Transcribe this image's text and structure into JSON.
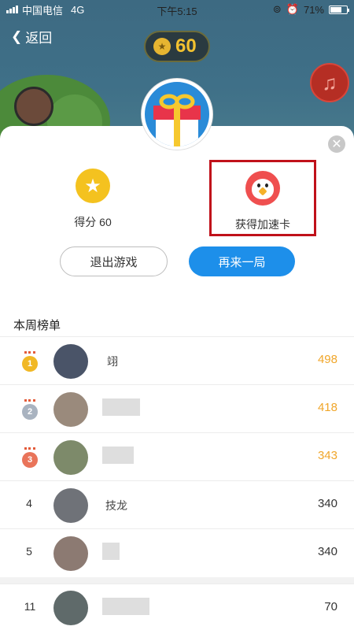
{
  "status_bar": {
    "carrier": "中国电信",
    "network": "4G",
    "time": "下午5:15",
    "battery": "71%",
    "battery_level": 0.71
  },
  "nav": {
    "back_label": "返回",
    "coins": "60"
  },
  "icons": {
    "music": "music-icon",
    "gift": "gift-icon",
    "close": "close-icon",
    "star": "star-icon"
  },
  "colors": {
    "primary": "#1d8fea",
    "gold": "#f0a62a",
    "highlight": "#c0111a"
  },
  "rewards": {
    "score_label": "得分 60",
    "card_label": "获得加速卡"
  },
  "buttons": {
    "exit": "退出游戏",
    "again": "再来一局"
  },
  "leaderboard": {
    "title": "本周榜单",
    "rows": [
      {
        "rank": "1",
        "name": "翊",
        "score": "498"
      },
      {
        "rank": "2",
        "name": "",
        "score": "418"
      },
      {
        "rank": "3",
        "name": "",
        "score": "343"
      },
      {
        "rank": "4",
        "name": "​技龙",
        "score": "340"
      },
      {
        "rank": "5",
        "name": "",
        "score": "340"
      }
    ],
    "self": {
      "rank": "11",
      "name": "",
      "score": "70"
    }
  }
}
